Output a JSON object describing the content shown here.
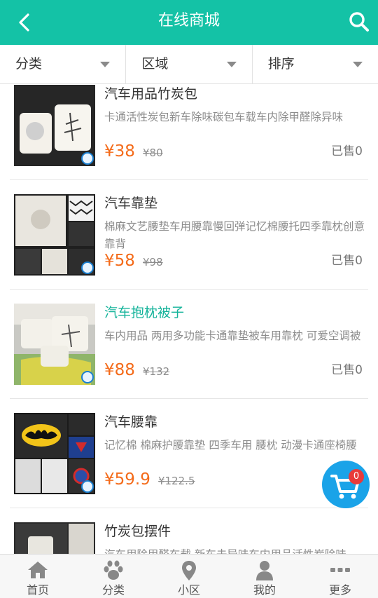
{
  "header": {
    "title": "在线商城"
  },
  "filters": [
    {
      "label": "分类"
    },
    {
      "label": "区域"
    },
    {
      "label": "排序"
    }
  ],
  "products": [
    {
      "name": "汽车用品竹炭包",
      "desc": "卡通活性炭包新车除味碳包车载车内除甲醛除异味",
      "price": "¥38",
      "old_price": "¥80",
      "sold": "已售0"
    },
    {
      "name": "汽车靠垫",
      "desc": "棉麻文艺腰垫车用腰靠慢回弹记忆棉腰托四季靠枕创意靠背",
      "price": "¥58",
      "old_price": "¥98",
      "sold": "已售0"
    },
    {
      "name": "汽车抱枕被子",
      "desc": "车内用品 两用多功能卡通靠垫被车用靠枕 可爱空调被",
      "price": "¥88",
      "old_price": "¥132",
      "sold": "已售0"
    },
    {
      "name": "汽车腰靠",
      "desc": "记忆棉 棉麻护腰靠垫 四季车用 腰枕 动漫卡通座椅腰",
      "price": "¥59.9",
      "old_price": "¥122.5",
      "sold": ""
    },
    {
      "name": "竹炭包摆件",
      "desc": "汽车用除甲醛车载 新车去异味车内用品活性炭除味",
      "price": "",
      "old_price": "",
      "sold": ""
    }
  ],
  "cart": {
    "count": "0"
  },
  "tabbar": [
    {
      "label": "首页",
      "icon": "home-icon"
    },
    {
      "label": "分类",
      "icon": "paw-icon"
    },
    {
      "label": "小区",
      "icon": "location-pin-icon"
    },
    {
      "label": "我的",
      "icon": "user-icon"
    },
    {
      "label": "更多",
      "icon": "more-icon"
    }
  ],
  "colors": {
    "accent": "#14c2a6",
    "price": "#f46b1a",
    "cart": "#1aa3e8",
    "badge": "#e83a3a"
  }
}
